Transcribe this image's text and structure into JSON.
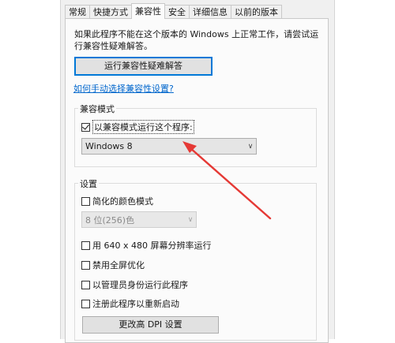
{
  "tabs": [
    "常规",
    "快捷方式",
    "兼容性",
    "安全",
    "详细信息",
    "以前的版本"
  ],
  "active_tab": 2,
  "description": "如果此程序不能在这个版本的 Windows 上正常工作，请尝试运行兼容性疑难解答。",
  "troubleshoot_button": "运行兼容性疑难解答",
  "manual_link": "如何手动选择兼容性设置?",
  "compat_mode": {
    "title": "兼容模式",
    "checkbox_label": "以兼容模式运行这个程序:",
    "checked": true,
    "selected_os": "Windows 8"
  },
  "settings": {
    "title": "设置",
    "reduced_color_label": "简化的颜色模式",
    "color_select": "8 位(256)色",
    "res_label": "用 640 x 480 屏幕分辨率运行",
    "fullscreen_label": "禁用全屏优化",
    "admin_label": "以管理员身份运行此程序",
    "register_label": "注册此程序以重新启动",
    "dpi_button": "更改高 DPI 设置"
  },
  "colors": {
    "accent": "#0078d7",
    "arrow": "#e53935",
    "link": "#0066cc"
  }
}
